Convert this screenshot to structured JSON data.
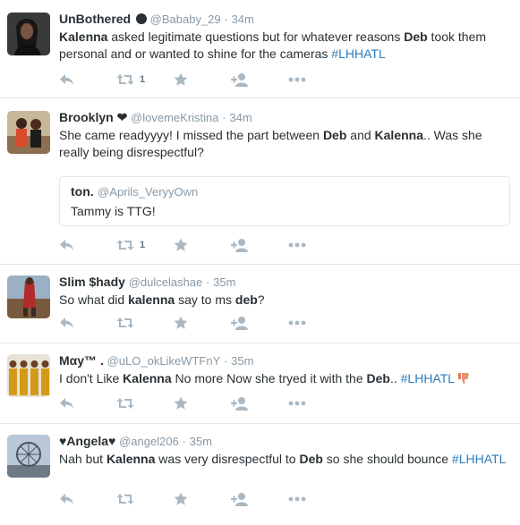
{
  "tweets": [
    {
      "name": "UnBothered",
      "handle": "@Bababy_29",
      "time": "34m",
      "text": [
        {
          "t": "Kalenna",
          "b": true
        },
        {
          "t": " asked legitimate questions but for whatever reasons "
        },
        {
          "t": "Deb",
          "b": true
        },
        {
          "t": " took them personal and or wanted to shine for the cameras "
        },
        {
          "t": "#LHHATL",
          "h": true
        }
      ],
      "retweet_count": "1"
    },
    {
      "name": "Brooklyn ❤",
      "handle": "@lovemeKristina",
      "time": "34m",
      "text": [
        {
          "t": "She came readyyyy! I missed the part between "
        },
        {
          "t": "Deb",
          "b": true
        },
        {
          "t": " and "
        },
        {
          "t": "Kalenna",
          "b": true
        },
        {
          "t": ".. Was she really being disrespectful?"
        }
      ],
      "quote": {
        "name": "ton.",
        "handle": "@Aprils_VeryyOwn",
        "text": "Tammy is TTG!"
      },
      "retweet_count": "1"
    },
    {
      "name": "Slim $hady",
      "handle": "@dulcelashae",
      "time": "35m",
      "text": [
        {
          "t": "So what did "
        },
        {
          "t": "kalenna",
          "b": true
        },
        {
          "t": " say to ms "
        },
        {
          "t": "deb",
          "b": true
        },
        {
          "t": "?"
        }
      ],
      "retweet_count": ""
    },
    {
      "name": "Mαy™ .",
      "handle": "@uLO_okLikeWTFnY",
      "time": "35m",
      "text": [
        {
          "t": "I don't Like "
        },
        {
          "t": "Kalenna",
          "b": true
        },
        {
          "t": " No more Now she tryed it with the "
        },
        {
          "t": "Deb",
          "b": true
        },
        {
          "t": ".. "
        },
        {
          "t": "#LHHATL",
          "h": true
        }
      ],
      "emoji": "thumbs-down-emoji",
      "retweet_count": ""
    },
    {
      "name": "♥Angela♥",
      "handle": "@angel206",
      "time": "35m",
      "text": [
        {
          "t": "Nah but "
        },
        {
          "t": "Kalenna",
          "b": true
        },
        {
          "t": " was very disrespectful to "
        },
        {
          "t": "Deb",
          "b": true
        },
        {
          "t": " so she should bounce "
        },
        {
          "t": "#LHHATL",
          "h": true
        }
      ],
      "retweet_count": ""
    }
  ],
  "colors": {
    "link": "#2b7bb9",
    "muted": "#8899a6",
    "icon": "#aab8c2",
    "divider": "#e1e8ed"
  },
  "icons": [
    "reply-icon",
    "retweet-icon",
    "favorite-icon",
    "follow-icon",
    "more-icon"
  ]
}
